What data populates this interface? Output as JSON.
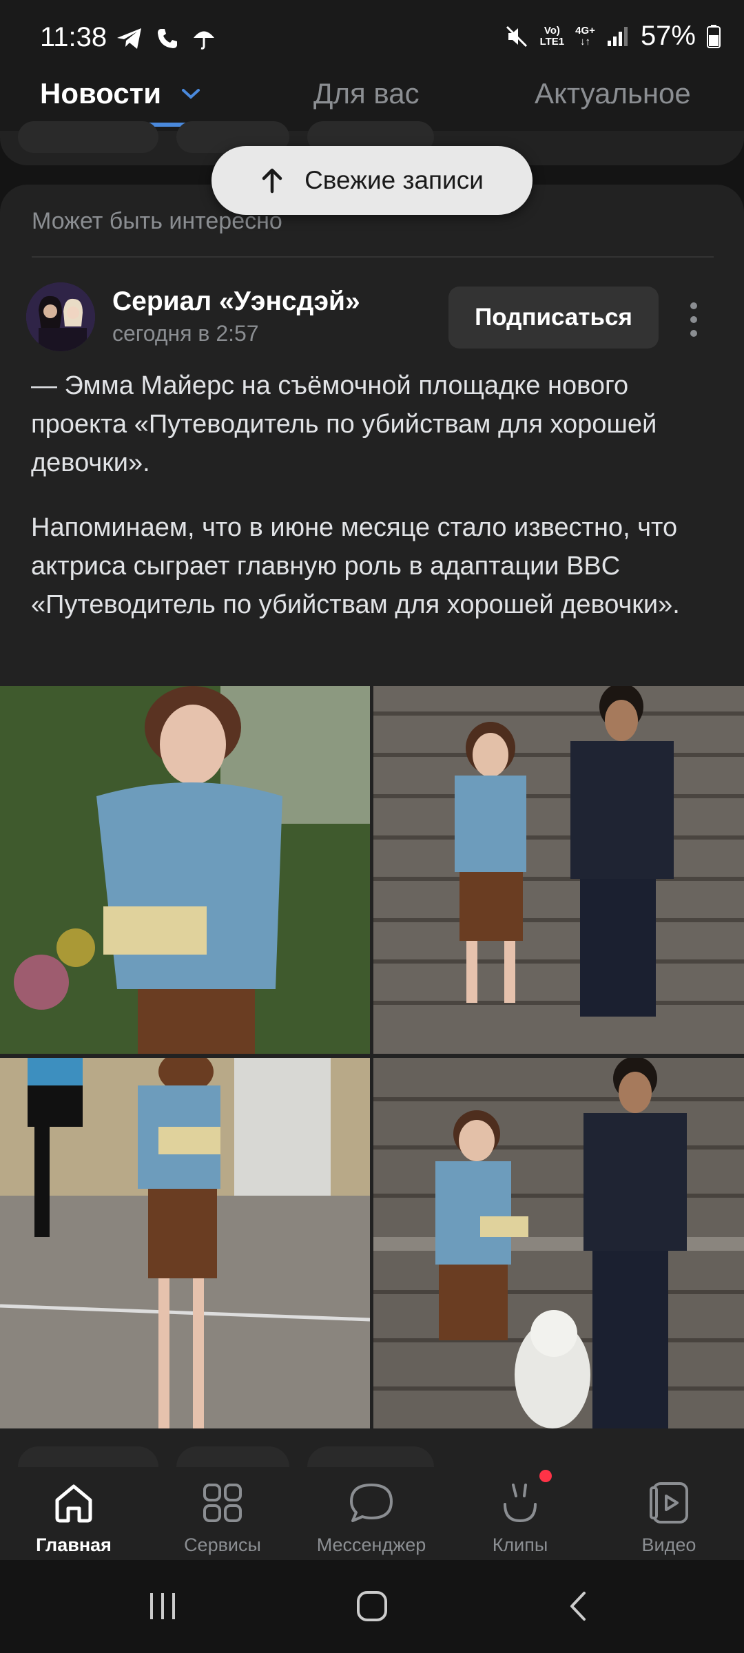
{
  "status_bar": {
    "time": "11:38",
    "network_top": "Vo)",
    "network_bottom": "LTE1",
    "net4g_top": "4G+",
    "battery": "57%"
  },
  "tabs": {
    "news": "Новости",
    "for_you": "Для вас",
    "actual": "Актуальное"
  },
  "fresh_button": {
    "label": "Свежие записи"
  },
  "post": {
    "section_label": "Может быть интересно",
    "author": "Сериал «Уэнсдэй»",
    "date": "сегодня в 2:57",
    "subscribe_label": "Подписаться",
    "paragraph1": "— Эмма Майерс на съёмочной площадке нового проекта «Путеводитель по убийствам для хорошей девочки».",
    "paragraph2": "Напоминаем, что в июне месяце стало известно, что актриса сыграет главную роль в адаптации BBC «Путеводитель по убийствам для хорошей девочки»."
  },
  "bottom_nav": {
    "items": [
      {
        "label": "Главная",
        "icon": "home-icon",
        "active": true
      },
      {
        "label": "Сервисы",
        "icon": "grid-icon",
        "active": false
      },
      {
        "label": "Мессенджер",
        "icon": "chat-bubble-icon",
        "active": false
      },
      {
        "label": "Клипы",
        "icon": "clips-icon",
        "active": false,
        "badge": true
      },
      {
        "label": "Видео",
        "icon": "video-play-icon",
        "active": false
      }
    ]
  },
  "colors": {
    "accent": "#4a89dc",
    "background": "#141414",
    "card": "#222222",
    "badge": "#ff3347"
  }
}
